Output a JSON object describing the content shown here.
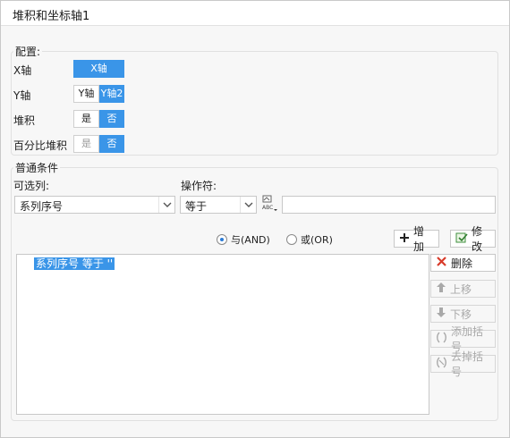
{
  "window": {
    "title": "堆积和坐标轴1"
  },
  "config": {
    "label": "配置:",
    "x_axis": {
      "label": "X轴",
      "options": [
        "X轴"
      ],
      "selected": 0
    },
    "y_axis": {
      "label": "Y轴",
      "options": [
        "Y轴",
        "Y轴2"
      ],
      "selected": 1
    },
    "stack": {
      "label": "堆积",
      "options": [
        "是",
        "否"
      ],
      "selected": 1
    },
    "percent_stack": {
      "label": "百分比堆积",
      "options": [
        "是",
        "否"
      ],
      "selected": 1,
      "disabled_options": [
        0
      ]
    }
  },
  "condition": {
    "label": "普通条件",
    "column_label": "可选列:",
    "column_value": "系列序号",
    "operator_label": "操作符:",
    "operator_value": "等于",
    "value_input": "",
    "radio_and": "与(AND)",
    "radio_or": "或(OR)",
    "radio_selected": "and",
    "add_label": "增加",
    "modify_label": "修改",
    "conditions": [
      "系列序号 等于 ''"
    ],
    "delete_label": "删除",
    "move_up_label": "上移",
    "move_down_label": "下移",
    "add_bracket_label": "添加括号",
    "remove_bracket_label": "去掉括号"
  },
  "colors": {
    "accent": "#3a95e8",
    "border": "#c8c8c8"
  }
}
